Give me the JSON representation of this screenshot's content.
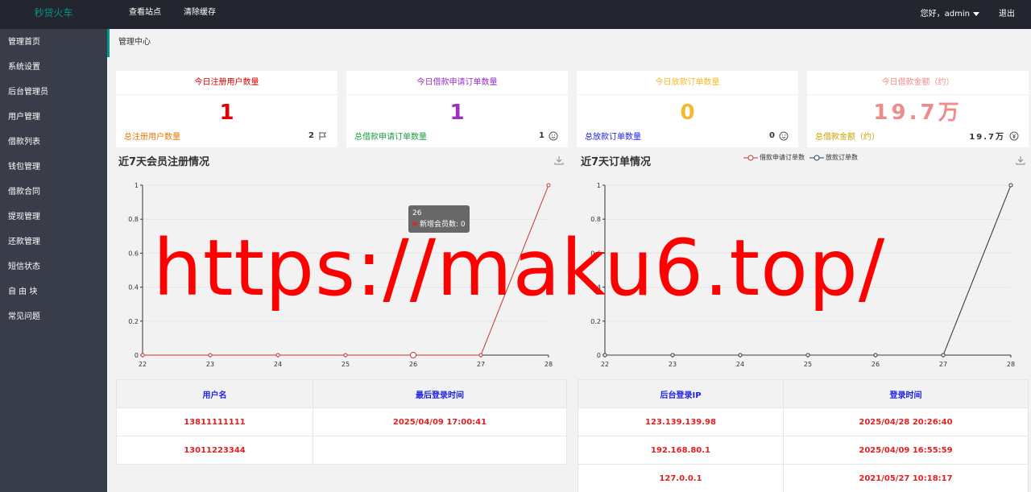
{
  "header": {
    "logo": "秒贷火车",
    "nav": [
      "查看站点",
      "清除缓存"
    ],
    "greeting": "您好，admin",
    "logout": "退出"
  },
  "sidebar": {
    "items": [
      "管理首页",
      "系统设置",
      "后台管理员",
      "用户管理",
      "借款列表",
      "钱包管理",
      "借款合同",
      "提现管理",
      "还款管理",
      "短信状态",
      "自 由 块",
      "常见问题"
    ]
  },
  "breadcrumb": "管理中心",
  "cards": [
    {
      "title": "今日注册用户数量",
      "value": "1",
      "foot_label": "总注册用户数量",
      "foot_value": "2",
      "color": "#e00000",
      "foot_color": "#e07b00",
      "icon": "flag-icon"
    },
    {
      "title": "今日借款申请订单数量",
      "value": "1",
      "foot_label": "总借款申请订单数量",
      "foot_value": "1",
      "color": "#9b2fc6",
      "foot_color": "#1e9b3e",
      "icon": "smile-icon"
    },
    {
      "title": "今日放款订单数量",
      "value": "0",
      "foot_label": "总放款订单数量",
      "foot_value": "0",
      "color": "#f5b82e",
      "foot_color": "#1e22e6",
      "icon": "smile-icon"
    },
    {
      "title": "今日借款金额（约）",
      "value": "19.7万",
      "foot_label": "总借款金额（约）",
      "foot_value": "19.7万",
      "color": "#f08b8b",
      "foot_color": "#c9a200",
      "icon": "yen-icon"
    }
  ],
  "charts": {
    "left_title": "近7天会员注册情况",
    "right_title": "近7天订单情况",
    "tooltip_title": "26",
    "tooltip_label": "新增会员数: 0",
    "right_legend": [
      "借款申请订单数",
      "放款订单数"
    ]
  },
  "chart_data": [
    {
      "type": "line",
      "title": "近7天会员注册情况",
      "x": [
        "22",
        "23",
        "24",
        "25",
        "26",
        "27",
        "28"
      ],
      "ylim": [
        0,
        1
      ],
      "yticks": [
        "0",
        "0.2",
        "0.4",
        "0.6",
        "0.8",
        "1"
      ],
      "series": [
        {
          "name": "新增会员数",
          "values": [
            0,
            0,
            0,
            0,
            0,
            0,
            1
          ],
          "color": "#c23531"
        }
      ]
    },
    {
      "type": "line",
      "title": "近7天订单情况",
      "x": [
        "22",
        "23",
        "24",
        "25",
        "26",
        "27",
        "28"
      ],
      "ylim": [
        0,
        1
      ],
      "yticks": [
        "0",
        "0.2",
        "0.4",
        "0.6",
        "0.8",
        "1"
      ],
      "series": [
        {
          "name": "借款申请订单数",
          "values": [
            0,
            0,
            0,
            0,
            0,
            0,
            1
          ],
          "color": "#c23531"
        },
        {
          "name": "放款订单数",
          "values": [
            0,
            0,
            0,
            0,
            0,
            0,
            1
          ],
          "color": "#2f4554"
        }
      ]
    }
  ],
  "users_table": {
    "headers": [
      "用户名",
      "最后登录时间"
    ],
    "rows": [
      [
        "13811111111",
        "2025/04/09 17:00:41"
      ],
      [
        "13011223344",
        ""
      ]
    ]
  },
  "login_table": {
    "headers": [
      "后台登录IP",
      "登录时间"
    ],
    "rows": [
      [
        "123.139.139.98",
        "2025/04/28 20:26:40"
      ],
      [
        "192.168.80.1",
        "2025/04/09 16:55:59"
      ],
      [
        "127.0.0.1",
        "2021/05/27 10:18:17"
      ]
    ]
  },
  "watermark": "https://maku6.top/"
}
